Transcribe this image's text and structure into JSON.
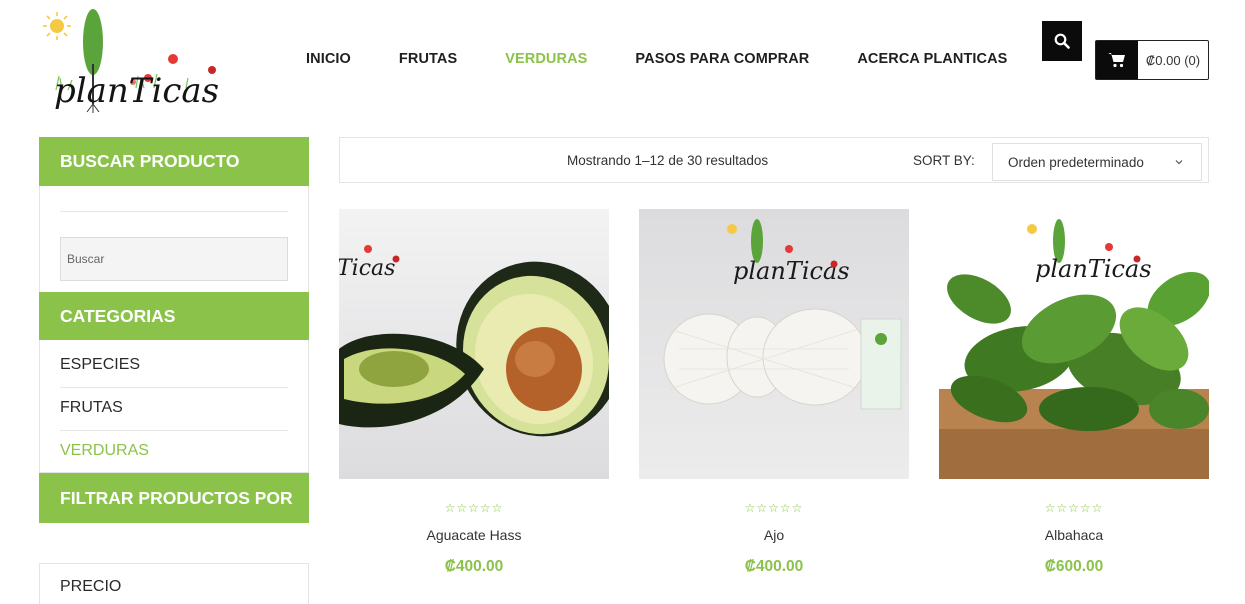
{
  "header": {
    "logo_text": "planTicas",
    "nav": [
      {
        "label": "INICIO",
        "active": false
      },
      {
        "label": "FRUTAS",
        "active": false
      },
      {
        "label": "VERDURAS",
        "active": true
      },
      {
        "label": "PASOS PARA COMPRAR",
        "active": false
      },
      {
        "label": "ACERCA PLANTICAS",
        "active": false
      }
    ],
    "search_icon": "search-icon",
    "cart_icon": "cart-icon",
    "cart_total": "₡0.00 (0)"
  },
  "sidebar": {
    "search_title": "BUSCAR PRODUCTO",
    "search_placeholder": "Buscar",
    "categories_title": "CATEGORIAS",
    "categories": [
      {
        "label": "ESPECIES",
        "active": false
      },
      {
        "label": "FRUTAS",
        "active": false
      },
      {
        "label": "VERDURAS",
        "active": true
      }
    ],
    "filter_title": "FILTRAR PRODUCTOS POR",
    "filter_price": "PRECIO"
  },
  "toolbar": {
    "result_count": "Mostrando 1–12 de 30 resultados",
    "sort_label": "SORT BY:",
    "sort_value": "Orden predeterminado"
  },
  "products": [
    {
      "name": "Aguacate Hass",
      "price": "₡400.00",
      "stars": "☆☆☆☆☆",
      "rating": 0
    },
    {
      "name": "Ajo",
      "price": "₡400.00",
      "stars": "☆☆☆☆☆",
      "rating": 0
    },
    {
      "name": "Albahaca",
      "price": "₡600.00",
      "stars": "☆☆☆☆☆",
      "rating": 0
    }
  ],
  "colors": {
    "accent": "#8bc34a",
    "dark": "#0b0b0b"
  }
}
